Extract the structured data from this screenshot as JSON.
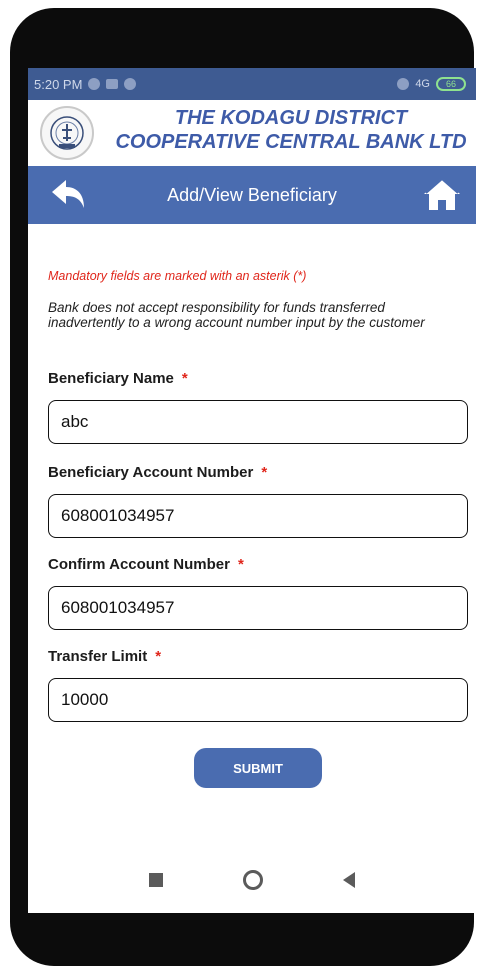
{
  "status_bar": {
    "time": "5:20 PM",
    "network": "4G",
    "battery": "66"
  },
  "bank": {
    "name_line1": "THE KODAGU DISTRICT",
    "name_line2": "COOPERATIVE CENTRAL BANK LTD"
  },
  "nav": {
    "title": "Add/View Beneficiary",
    "back_icon": "back-arrow-icon",
    "home_icon": "home-icon"
  },
  "form": {
    "mandatory_note": "Mandatory fields are marked with an asterik (*)",
    "disclaimer": "Bank does not accept responsibility for funds transferred inadvertently to a wrong account number input by the customer",
    "asterisk": "*",
    "fields": [
      {
        "label": "Beneficiary Name",
        "value": "abc"
      },
      {
        "label": "Beneficiary Account Number",
        "value": "608001034957"
      },
      {
        "label": "Confirm Account Number",
        "value": "608001034957"
      },
      {
        "label": "Transfer Limit",
        "value": "10000"
      }
    ],
    "submit_label": "SUBMIT"
  },
  "colors": {
    "accent": "#4a6cb0",
    "bank_text": "#3e5ba8",
    "required": "#e0261b"
  }
}
